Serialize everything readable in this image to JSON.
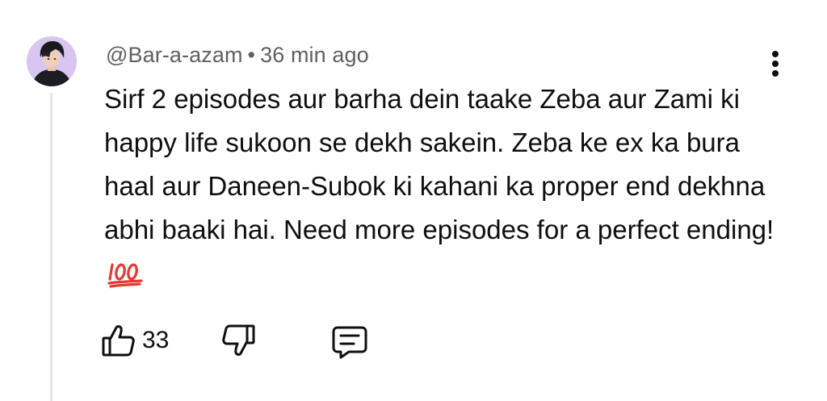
{
  "comment": {
    "author": "@Bar-a-azam",
    "separator": "•",
    "timestamp": "36 min ago",
    "text": "Sirf 2 episodes aur barha dein taake Zeba aur Zami ki happy life sukoon se dekh sakein. Zeba ke ex ka bura haal aur Daneen-Subok ki kahani ka proper end dekhna abhi baaki hai. Need more episodes for a perfect ending!",
    "emoji": "💯",
    "like_count": "33"
  },
  "icons": {
    "avatar": "user-avatar",
    "more": "more-vertical-icon",
    "like": "thumbs-up-icon",
    "dislike": "thumbs-down-icon",
    "reply": "comment-icon"
  },
  "colors": {
    "meta_text": "#606060",
    "body_text": "#0f0f0f",
    "thread_line": "#e5e5e5",
    "emoji_red": "#e53935",
    "avatar_bg": "#d8c6f0"
  }
}
